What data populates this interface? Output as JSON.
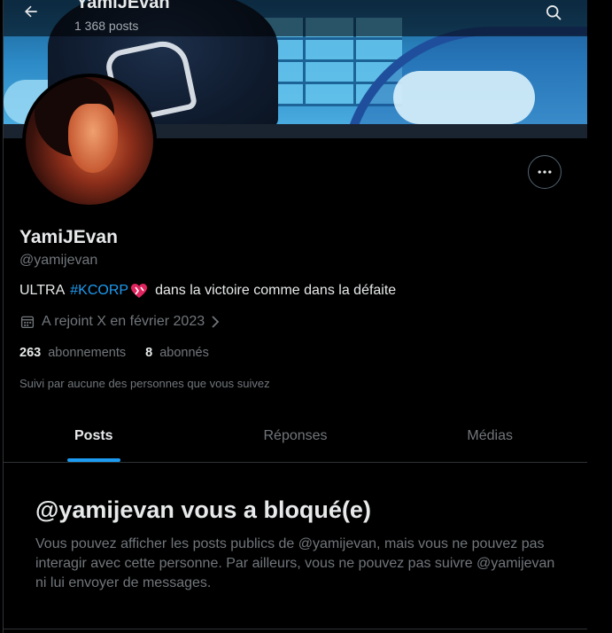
{
  "header": {
    "title": "YamiJEvan",
    "posts_count": "1 368 posts",
    "back_icon": "arrow-left-icon",
    "search_icon": "search-icon"
  },
  "profile": {
    "display_name": "YamiJEvan",
    "handle": "@yamijevan",
    "bio_prefix": "ULTRA",
    "bio_hashtag": "#KCORP",
    "bio_suffix": "dans la victoire comme dans la défaite",
    "joined": "A rejoint X en février 2023",
    "following_count": "263",
    "following_label": "abonnements",
    "followers_count": "8",
    "followers_label": "abonnés",
    "followed_by": "Suivi par aucune des personnes que vous suivez"
  },
  "tabs": [
    {
      "label": "Posts",
      "active": true
    },
    {
      "label": "Réponses",
      "active": false
    },
    {
      "label": "Médias",
      "active": false
    }
  ],
  "blocked": {
    "title": "@yamijevan vous a bloqué(e)",
    "description": "Vous pouvez afficher les posts publics de @yamijevan, mais vous ne pouvez pas interagir avec cette personne. Par ailleurs, vous ne pouvez pas suivre @yamijevan ni lui envoyer de messages."
  },
  "colors": {
    "accent": "#1d9bf0",
    "background": "#000000",
    "text_primary": "#e7e9ea",
    "text_secondary": "#71767b",
    "divider": "#2f3336"
  }
}
